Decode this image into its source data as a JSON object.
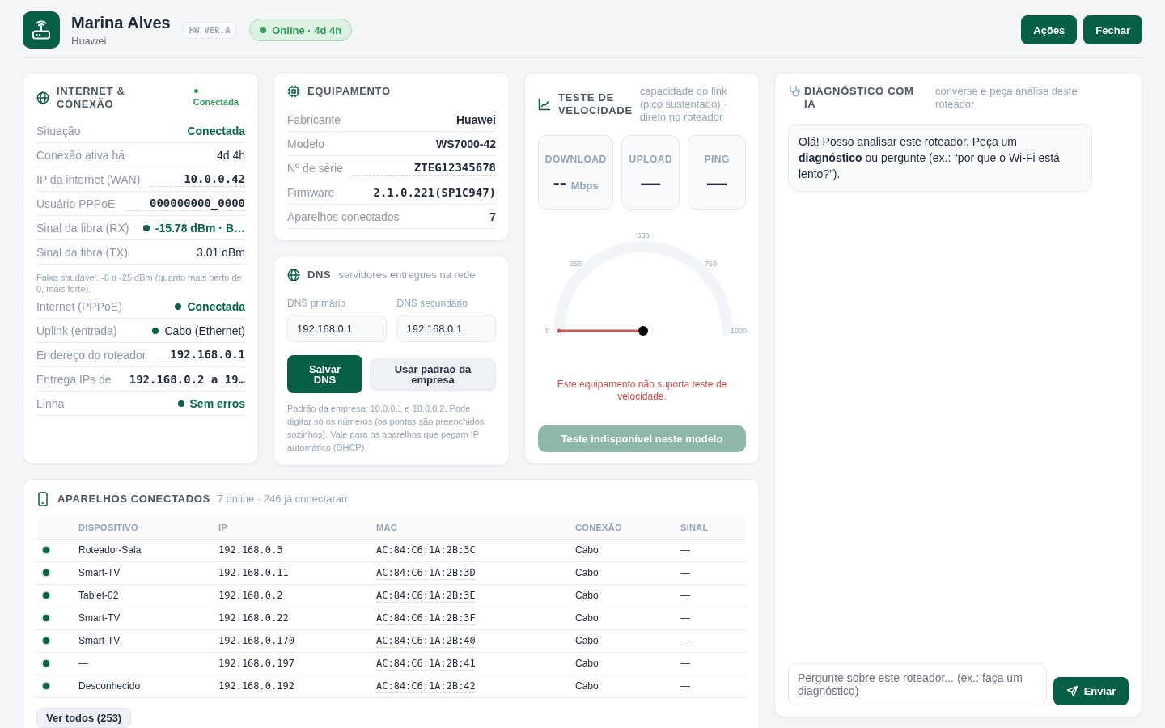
{
  "header": {
    "title": "Marina Alves",
    "subtitle": "Huawei",
    "hw_badge": "HW VER.A",
    "status": {
      "label": "Online · 4d 4h",
      "online": true
    },
    "actions": [
      "Ações",
      "Fechar"
    ]
  },
  "internet": {
    "title": "INTERNET & CONEXÃO",
    "status": {
      "label": "Conectada",
      "online": true
    },
    "items": [
      {
        "kind": "row",
        "label": "Situação",
        "value": "Conectada",
        "positive": true,
        "mono": false,
        "dot": false,
        "underlined": false
      },
      {
        "kind": "row",
        "label": "Conexão ativa há",
        "value": "4d 4h",
        "positive": false,
        "mono": false,
        "dot": false,
        "underlined": false
      },
      {
        "kind": "row",
        "label": "IP da internet (WAN)",
        "value": "10.0.0.42",
        "positive": false,
        "mono": true,
        "dot": false,
        "underlined": true
      },
      {
        "kind": "row",
        "label": "Usuário PPPoE",
        "value": "000000000_0000",
        "positive": false,
        "mono": true,
        "dot": false,
        "underlined": true
      },
      {
        "kind": "row",
        "label": "Sinal da fibra (RX)",
        "value": "-15.78 dBm · B…",
        "positive": true,
        "mono": false,
        "dot": true,
        "underlined": false
      },
      {
        "kind": "row",
        "label": "Sinal da fibra (TX)",
        "value": "3.01 dBm",
        "positive": false,
        "mono": false,
        "dot": false,
        "underlined": false
      },
      {
        "kind": "note",
        "text": "Faixa saudável: -8 a -25 dBm (quanto mais perto de 0, mais forte)."
      },
      {
        "kind": "row",
        "label": "Internet (PPPoE)",
        "value": "Conectada",
        "positive": true,
        "mono": false,
        "dot": true,
        "underlined": false
      },
      {
        "kind": "row",
        "label": "Uplink (entrada)",
        "value": "Cabo (Ethernet)",
        "positive": false,
        "mono": false,
        "dot": true,
        "underlined": false
      },
      {
        "kind": "row",
        "label": "Endereço do roteador",
        "value": "192.168.0.1",
        "positive": false,
        "mono": true,
        "dot": false,
        "underlined": true
      },
      {
        "kind": "row",
        "label": "Entrega IPs de",
        "value": "192.168.0.2 a 19…",
        "positive": false,
        "mono": true,
        "dot": false,
        "underlined": false
      },
      {
        "kind": "row",
        "label": "Linha",
        "value": "Sem erros",
        "positive": true,
        "mono": false,
        "dot": true,
        "underlined": false
      }
    ]
  },
  "equipment": {
    "title": "EQUIPAMENTO",
    "items": [
      {
        "kind": "row",
        "label": "Fabricante",
        "value": "Huawei",
        "mono": false,
        "underlined": false
      },
      {
        "kind": "row",
        "label": "Modelo",
        "value": "WS7000-42",
        "mono": false,
        "underlined": false
      },
      {
        "kind": "row",
        "label": "Nº de série",
        "value": "ZTEG12345678",
        "mono": true,
        "underlined": true
      },
      {
        "kind": "row",
        "label": "Firmware",
        "value": "2.1.0.221(SP1C947)",
        "mono": true,
        "underlined": false
      },
      {
        "kind": "row",
        "label": "Aparelhos conectados",
        "value": "7",
        "mono": false,
        "underlined": false
      }
    ]
  },
  "dns": {
    "title": "DNS",
    "subtitle": "servidores entregues na rede",
    "fields": [
      {
        "label": "DNS primário",
        "value": "192.168.0.1"
      },
      {
        "label": "DNS secundário",
        "value": "192.168.0.1"
      }
    ],
    "buttons": [
      {
        "label": "Salvar DNS",
        "kind": "primary"
      },
      {
        "label": "Usar padrão da empresa",
        "kind": "secondary"
      }
    ],
    "note": "Padrão da empresa: 10.0.0.1 e 10.0.0.2. Pode digitar só os números (os pontos são preenchidos sozinhos). Vale para os aparelhos que pegam IP automático (DHCP)."
  },
  "speed": {
    "title": "TESTE DE VELOCIDADE",
    "subtitle": "capacidade do link (pico sustentado) · direto no roteador",
    "stats": [
      {
        "label": "DOWNLOAD",
        "value": "--",
        "unit": "Mbps"
      },
      {
        "label": "UPLOAD",
        "value": "—"
      },
      {
        "label": "PING",
        "value": "—"
      }
    ],
    "gauge": {
      "level": 0,
      "ticks": [
        "0",
        "250",
        "500",
        "750",
        "1000"
      ]
    },
    "error": "Este equipamento não suporta teste de velocidade.",
    "button": {
      "label": "Teste indisponível neste modelo",
      "disabled": true
    }
  },
  "ai": {
    "title": "DIAGNÓSTICO COM IA",
    "subtitle": "converse e peça análise deste roteador",
    "messages": [
      {
        "kind": "assistant",
        "text": "Olá! Posso analisar este roteador. Peça um **diagnóstico** ou pergunte (ex.: “por que o Wi-Fi está lento?”)."
      }
    ],
    "input": {
      "placeholder": "Pergunte sobre este roteador... (ex.: faça um diagnóstico)"
    },
    "send": "Enviar"
  },
  "devices": {
    "title": "APARELHOS CONECTADOS",
    "subtitle": "7 online · 246 já conectaram",
    "columns": [
      "DISPOSITIVO",
      "IP",
      "MAC",
      "CONEXÃO",
      "SINAL"
    ],
    "rows": [
      {
        "online": true,
        "device": "Roteador-Sala",
        "ip": "192.168.0.3",
        "mac": "AC:84:C6:1A:2B:3C",
        "connection": "Cabo",
        "signal": "—"
      },
      {
        "online": true,
        "device": "Smart-TV",
        "ip": "192.168.0.11",
        "mac": "AC:84:C6:1A:2B:3D",
        "connection": "Cabo",
        "signal": "—"
      },
      {
        "online": true,
        "device": "Tablet-02",
        "ip": "192.168.0.2",
        "mac": "AC:84:C6:1A:2B:3E",
        "connection": "Cabo",
        "signal": "—"
      },
      {
        "online": true,
        "device": "Smart-TV",
        "ip": "192.168.0.22",
        "mac": "AC:84:C6:1A:2B:3F",
        "connection": "Cabo",
        "signal": "—"
      },
      {
        "online": true,
        "device": "Smart-TV",
        "ip": "192.168.0.170",
        "mac": "AC:84:C6:1A:2B:40",
        "connection": "Cabo",
        "signal": "—"
      },
      {
        "online": true,
        "device": "—",
        "ip": "192.168.0.197",
        "mac": "AC:84:C6:1A:2B:41",
        "connection": "Cabo",
        "signal": "—"
      },
      {
        "online": true,
        "device": "Desconhecido",
        "ip": "192.168.0.192",
        "mac": "AC:84:C6:1A:2B:42",
        "connection": "Cabo",
        "signal": "—"
      }
    ],
    "more": "Ver todos (253)"
  }
}
